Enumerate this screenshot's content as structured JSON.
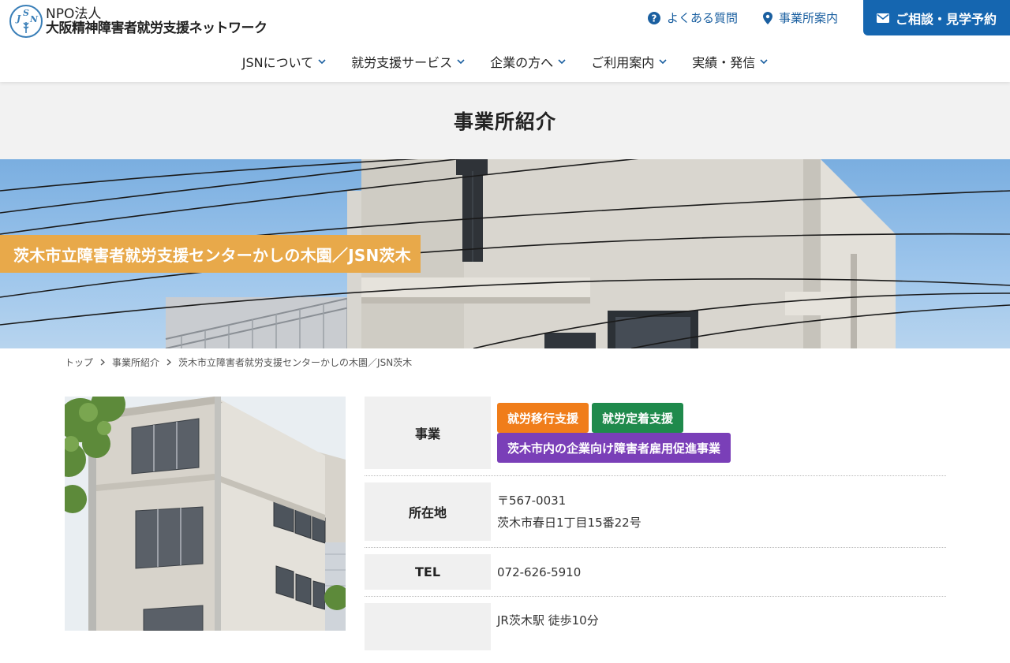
{
  "header": {
    "org_prefix": "NPO法人",
    "org_name": "大阪精神障害者就労支援ネットワーク",
    "logo_letters": [
      "J",
      "S",
      "N"
    ],
    "faq_label": "よくある質問",
    "offices_label": "事業所案内",
    "cta_label": "ご相談・見学予約",
    "accent_color": "#1566b0"
  },
  "nav": {
    "items": [
      {
        "label": "JSNについて"
      },
      {
        "label": "就労支援サービス"
      },
      {
        "label": "企業の方へ"
      },
      {
        "label": "ご利用案内"
      },
      {
        "label": "実績・発信"
      }
    ]
  },
  "page": {
    "title": "事業所紹介",
    "hero_label": "茨木市立障害者就労支援センターかしの木園／JSN茨木",
    "hero_label_color": "#e8a94a"
  },
  "breadcrumb": {
    "items": [
      {
        "label": "トップ"
      },
      {
        "label": "事業所紹介"
      },
      {
        "label": "茨木市立障害者就労支援センターかしの木園／JSN茨木"
      }
    ]
  },
  "info": {
    "business": {
      "label": "事業",
      "tags": [
        {
          "label": "就労移行支援",
          "color": "#f07d1a"
        },
        {
          "label": "就労定着支援",
          "color": "#1f8a4c"
        },
        {
          "label": "茨木市内の企業向け障害者雇用促進事業",
          "color": "#7a3fb8"
        }
      ]
    },
    "address": {
      "label": "所在地",
      "postal": "〒567-0031",
      "street": "茨木市春日1丁目15番22号"
    },
    "tel": {
      "label": "TEL",
      "value": "072-626-5910"
    },
    "access": {
      "label": "",
      "value": "JR茨木駅 徒歩10分"
    }
  }
}
